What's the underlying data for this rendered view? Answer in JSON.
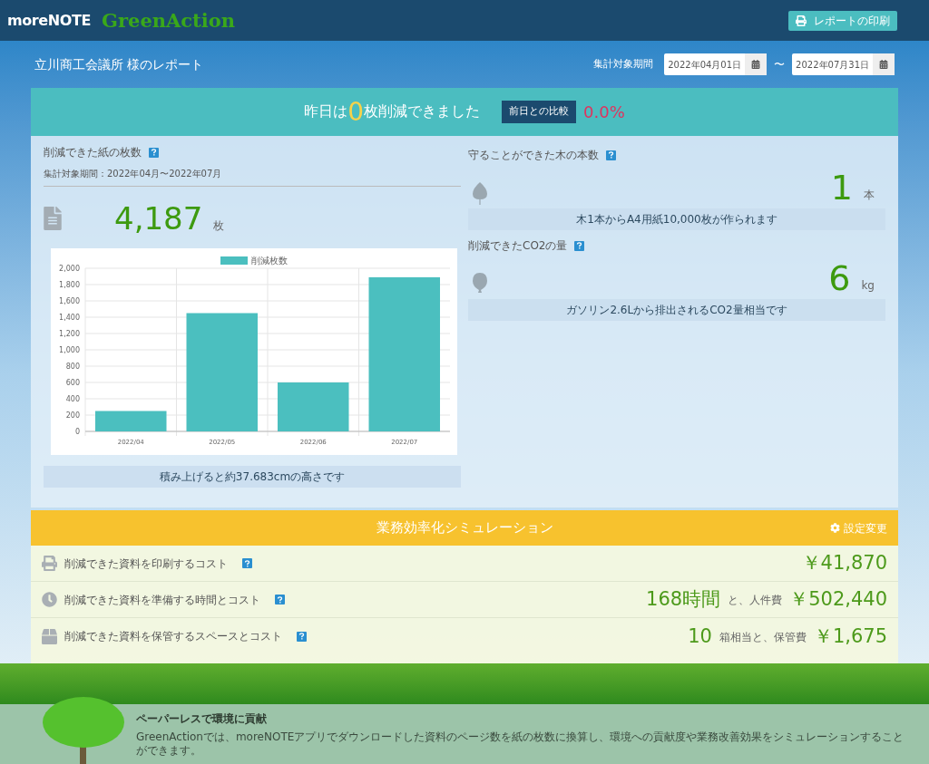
{
  "header": {
    "logo": "moreNOTE",
    "brand": "GreenAction",
    "print_button": "レポートの印刷"
  },
  "report": {
    "title": "立川商工会議所 様のレポート",
    "period_label": "集計対象期間",
    "start_date": "2022年04月01日",
    "separator": "〜",
    "end_date": "2022年07月31日"
  },
  "banner": {
    "prefix": "昨日は",
    "count": "0",
    "suffix": "枚削減できました",
    "compare_label": "前日との比較",
    "compare_value": "0.0%"
  },
  "paper": {
    "title": "削減できた紙の枚数",
    "period": "集計対象期間：2022年04月〜2022年07月",
    "value": "4,187",
    "unit": "枚",
    "note": "積み上げると約37.683cmの高さです",
    "chart_data": {
      "type": "bar",
      "grid": true,
      "categories": [
        "2022/04",
        "2022/05",
        "2022/06",
        "2022/07"
      ],
      "series": [
        {
          "name": "削減枚数",
          "color": "#4bbfbf",
          "values": [
            250,
            1450,
            600,
            1890
          ]
        }
      ],
      "ylim": [
        0,
        2000
      ],
      "yticks": [
        {
          "value": 0,
          "label": "0"
        },
        {
          "value": 200,
          "label": "200"
        },
        {
          "value": 400,
          "label": "400"
        },
        {
          "value": 600,
          "label": "600"
        },
        {
          "value": 800,
          "label": "800"
        },
        {
          "value": 1000,
          "label": "1,000"
        },
        {
          "value": 1200,
          "label": "1,200"
        },
        {
          "value": 1400,
          "label": "1,400"
        },
        {
          "value": 1600,
          "label": "1,600"
        },
        {
          "value": 1800,
          "label": "1,800"
        },
        {
          "value": 2000,
          "label": "2,000"
        }
      ]
    }
  },
  "trees": {
    "title": "守ることができた木の本数",
    "value": "1",
    "unit": "本",
    "note": "木1本からA4用紙10,000枚が作られます"
  },
  "co2": {
    "title": "削減できたCO2の量",
    "value": "6",
    "unit": "kg",
    "note": "ガソリン2.6Lから排出されるCO2量相当です"
  },
  "simulation": {
    "title": "業務効率化シミュレーション",
    "settings_link": "設定変更",
    "rows": [
      {
        "kind": "print",
        "label": "削減できた資料を印刷するコスト",
        "parts": [
          {
            "text": "￥41,870",
            "big": true
          }
        ]
      },
      {
        "kind": "time",
        "label": "削減できた資料を準備する時間とコスト",
        "parts": [
          {
            "text": "168時間",
            "big": true
          },
          {
            "text": "と、人件費",
            "big": false
          },
          {
            "text": "￥502,440",
            "big": true
          }
        ]
      },
      {
        "kind": "storage",
        "label": "削減できた資料を保管するスペースとコスト",
        "parts": [
          {
            "text": "10",
            "big": true
          },
          {
            "text": "箱相当と、保管費",
            "big": false
          },
          {
            "text": "￥1,675",
            "big": true
          }
        ]
      }
    ]
  },
  "footer": {
    "title": "ペーパーレスで環境に貢献",
    "text": "GreenActionでは、moreNOTEアプリでダウンロードした資料のページ数を紙の枚数に換算し、環境への貢献度や業務改善効果をシミュレーションすることができます。"
  }
}
